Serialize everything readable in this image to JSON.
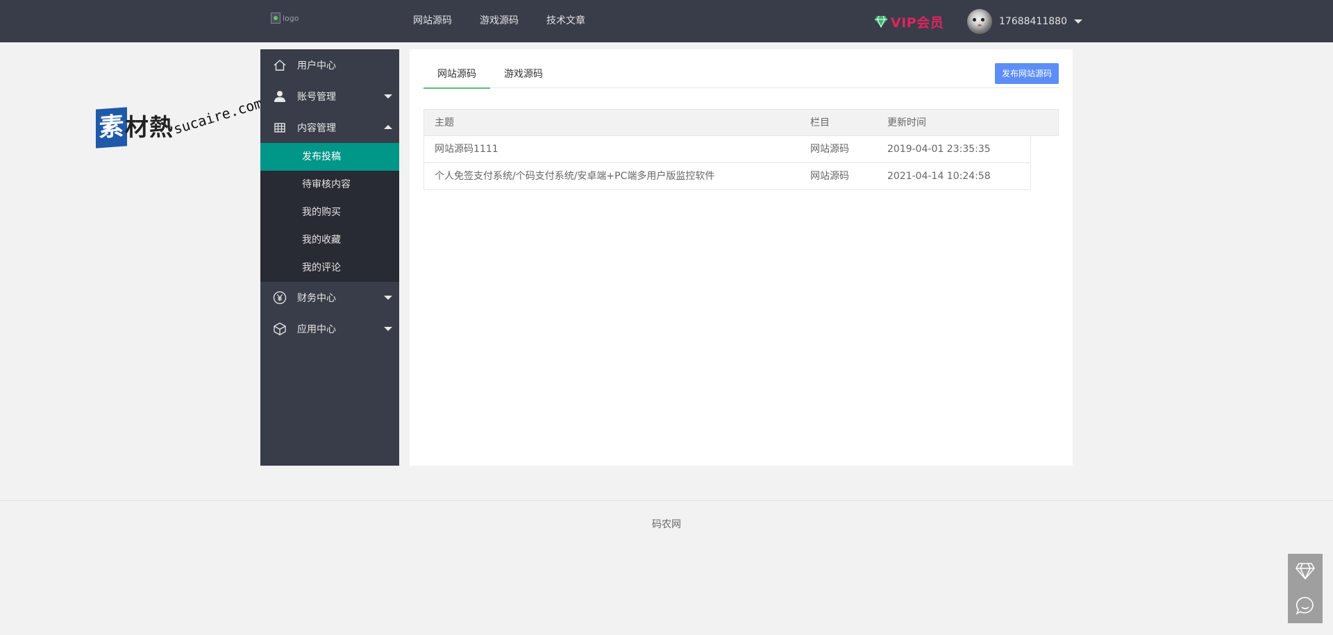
{
  "header": {
    "logo_alt": "logo",
    "nav": [
      "网站源码",
      "游戏源码",
      "技术文章"
    ],
    "vip_label": "VIP会员",
    "username": "17688411880"
  },
  "watermark": {
    "glyph": "素",
    "text": "材熱",
    "domain": "sucaire.com"
  },
  "sidebar": {
    "items": [
      {
        "label": "用户中心",
        "icon": "home-icon"
      },
      {
        "label": "账号管理",
        "icon": "user-icon"
      },
      {
        "label": "内容管理",
        "icon": "grid-icon"
      }
    ],
    "subitems": [
      "发布投稿",
      "待审核内容",
      "我的购买",
      "我的收藏",
      "我的评论"
    ],
    "bottom_items": [
      {
        "label": "财务中心",
        "icon": "yen-icon"
      },
      {
        "label": "应用中心",
        "icon": "cube-icon"
      }
    ]
  },
  "main": {
    "tabs": [
      "网站源码",
      "游戏源码"
    ],
    "publish_button": "发布网站源码",
    "table": {
      "headers": [
        "主题",
        "栏目",
        "更新时间"
      ],
      "rows": [
        [
          "网站源码1111",
          "网站源码",
          "2019-04-01 23:35:35"
        ],
        [
          "个人免签支付系统/个码支付系统/安卓端+PC端多用户版监控软件",
          "网站源码",
          "2021-04-14 10:24:58"
        ]
      ]
    }
  },
  "footer": {
    "text": "码农网"
  },
  "colors": {
    "header_bg": "#393d49",
    "active_sub": "#009688",
    "vip": "#e0245e",
    "button": "#5d8ef5",
    "tab_underline": "#5fb878"
  }
}
